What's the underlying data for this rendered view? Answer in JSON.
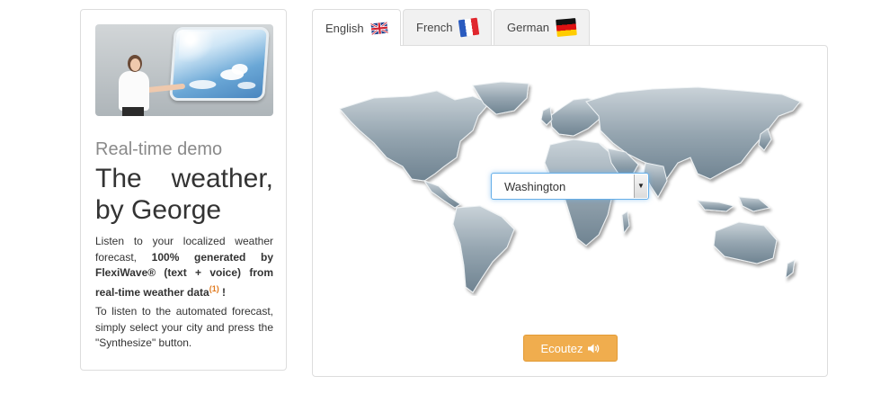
{
  "intro": {
    "subtitle": "Real-time demo",
    "title_line1": "The weather,",
    "title_line2": "by George",
    "p1_pre": "Listen to your localized weather forecast, ",
    "p1_bold": "100% generated by FlexiWave® (text + voice) from real-time weather data",
    "p1_sup": "(1)",
    "p1_post": " !",
    "p2": "To listen to the automated forecast, simply select your city and press the \"Synthesize\" button."
  },
  "tabs": [
    {
      "label": "English",
      "flag": "uk-flag-icon",
      "active": true
    },
    {
      "label": "French",
      "flag": "france-flag-icon",
      "active": false
    },
    {
      "label": "German",
      "flag": "germany-flag-icon",
      "active": false
    }
  ],
  "city_select": {
    "selected": "Washington"
  },
  "listen_button": {
    "label": "Ecoutez",
    "icon": "speaker-icon"
  },
  "colors": {
    "accent": "#f0ad4e",
    "focus": "#66afe9",
    "map": "#8d9fab"
  }
}
